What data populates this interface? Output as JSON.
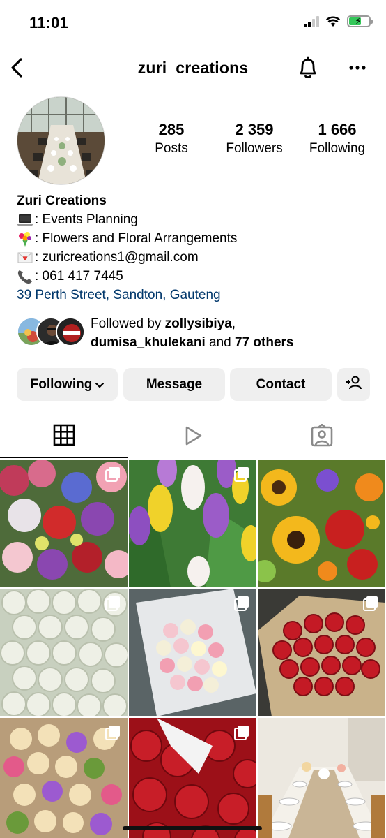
{
  "status_bar": {
    "time": "11:01"
  },
  "header": {
    "username": "zuri_creations"
  },
  "stats": {
    "posts_count": "285",
    "posts_label": "Posts",
    "followers_count": "2 359",
    "followers_label": "Followers",
    "following_count": "1 666",
    "following_label": "Following"
  },
  "bio": {
    "name": "Zuri Creations",
    "lines": [
      {
        "icon": "laptop-icon",
        "text": ": Events Planning"
      },
      {
        "icon": "bouquet-icon",
        "text": ": Flowers and Floral Arrangements"
      },
      {
        "icon": "love-letter-icon",
        "text": ": zuricreations1@gmail.com"
      },
      {
        "icon": "telephone-icon",
        "text": ": 061 417 7445"
      }
    ],
    "address": "39 Perth Street, Sandton, Gauteng"
  },
  "followed_by": {
    "prefix": "Followed by ",
    "user1": "zollysibiya",
    "sep": ",",
    "user2": "dumisa_khulekani",
    "middle": " and ",
    "others": "77 others"
  },
  "buttons": {
    "following": "Following",
    "message": "Message",
    "contact": "Contact"
  },
  "tabs": [
    "grid-icon",
    "reels-icon",
    "tagged-icon"
  ],
  "grid": [
    {
      "subject": "mixed bouquet",
      "multi": true
    },
    {
      "subject": "tulips",
      "multi": true
    },
    {
      "subject": "sunflower bouquet",
      "multi": false
    },
    {
      "subject": "white roses",
      "multi": true
    },
    {
      "subject": "pastel rose bouquet",
      "multi": true
    },
    {
      "subject": "red roses bouquet",
      "multi": true
    },
    {
      "subject": "cream rose bouquet",
      "multi": true
    },
    {
      "subject": "red roses",
      "multi": true
    },
    {
      "subject": "event table setting",
      "multi": false
    }
  ],
  "colors": {
    "link": "#00376b",
    "button_bg": "#efefef",
    "battery": "#34c759"
  }
}
